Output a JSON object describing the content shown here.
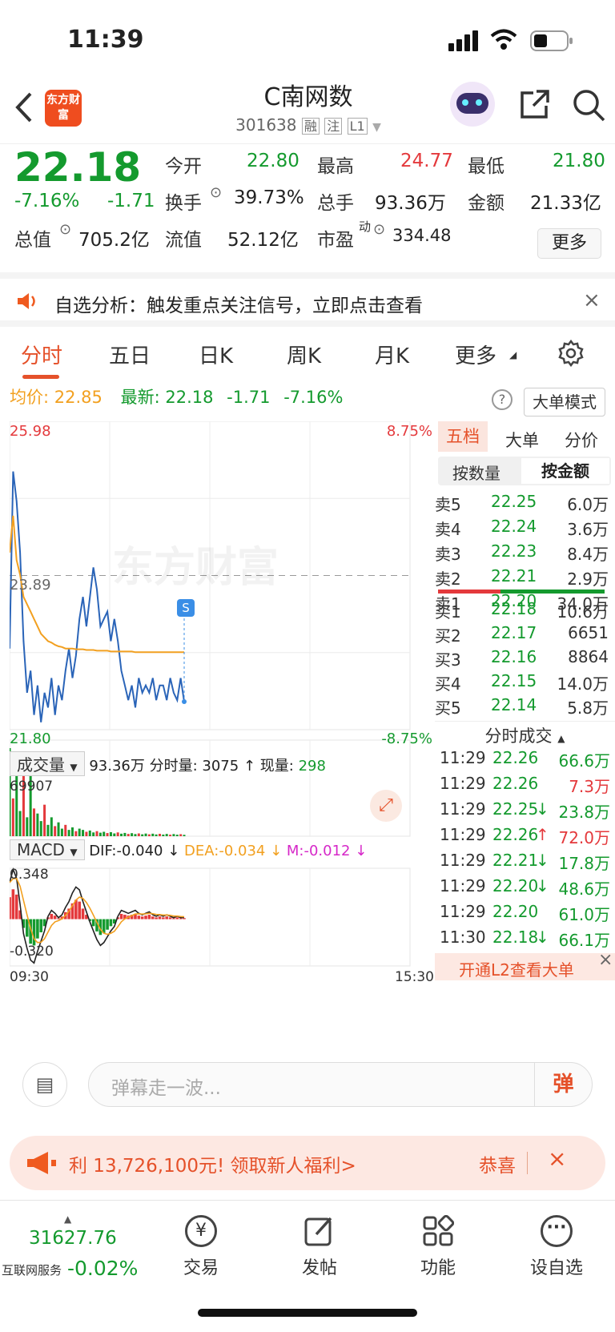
{
  "status": {
    "time": "11:39"
  },
  "header": {
    "title": "C南网数",
    "code": "301638",
    "tags": [
      "融",
      "注",
      "L1"
    ],
    "logo_text": "东方财富"
  },
  "quote": {
    "price": "22.18",
    "change_pct": "-7.16%",
    "change": "-1.71",
    "open_label": "今开",
    "open": "22.80",
    "high_label": "最高",
    "high": "24.77",
    "low_label": "最低",
    "low": "21.80",
    "turnover_label": "换手",
    "turnover": "39.73%",
    "volume_label": "总手",
    "volume": "93.36万",
    "amount_label": "金额",
    "amount": "21.33亿",
    "mktcap_label": "总值",
    "mktcap": "705.2亿",
    "float_label": "流值",
    "float": "52.12亿",
    "pe_label": "市盈",
    "pe_sup": "动",
    "pe": "334.48",
    "more_label": "更多"
  },
  "notice": {
    "text": "自选分析：触发重点关注信号，立即点击查看"
  },
  "tabs": [
    "分时",
    "五日",
    "日K",
    "周K",
    "月K",
    "更多"
  ],
  "infobar": {
    "avg_label": "均价:",
    "avg": "22.85",
    "latest_label": "最新:",
    "latest": "22.18",
    "latest_change": "-1.71",
    "latest_pct": "-7.16%",
    "mode_button": "大单模式"
  },
  "chart": {
    "price_top": "25.98",
    "pct_top": "8.75%",
    "price_mid": "23.89",
    "price_bottom": "21.80",
    "pct_bottom": "-8.75%",
    "watermark": "东方财富",
    "s_marker": "S",
    "vol_selector": "成交量",
    "vol_total": "93.36万",
    "vol_minute_label": "分时量:",
    "vol_minute": "3075",
    "vol_now_label": "现量:",
    "vol_now": "298",
    "vol_top": "69907",
    "macd_selector": "MACD",
    "dif": "DIF:-0.040",
    "dea": "DEA:-0.034",
    "m": "M:-0.012",
    "macd_top": "0.348",
    "macd_bottom": "-0.320",
    "time_start": "09:30",
    "time_end": "15:30"
  },
  "chart_data": {
    "type": "line",
    "title": "",
    "y_range": [
      21.8,
      25.98
    ],
    "prev_close": 23.89,
    "series": [
      {
        "values": [
          22.9,
          25.3,
          24.9,
          24.2,
          23.0,
          22.3,
          22.6,
          22.0,
          22.4,
          21.9,
          22.3,
          22.1,
          22.5,
          22.0,
          22.4,
          22.2,
          22.6,
          22.9,
          22.5,
          22.8,
          23.3,
          23.6,
          23.2,
          23.6,
          24.0,
          23.7,
          23.2,
          23.3,
          23.4,
          23.0,
          23.3,
          23.0,
          22.6,
          22.4,
          22.2,
          22.4,
          22.1,
          22.5,
          22.3,
          22.4,
          22.3,
          22.5,
          22.2,
          22.4,
          22.4,
          22.2,
          22.5,
          22.3,
          22.2,
          22.5,
          22.18
        ]
      },
      {
        "values": [
          24.2,
          24.7,
          24.1,
          23.9,
          23.6,
          23.5,
          23.4,
          23.3,
          23.2,
          23.1,
          23.05,
          23.0,
          22.98,
          22.95,
          22.93,
          22.92,
          22.9,
          22.9,
          22.9,
          22.89,
          22.89,
          22.89,
          22.88,
          22.88,
          22.88,
          22.87,
          22.87,
          22.87,
          22.87,
          22.86,
          22.86,
          22.86,
          22.86,
          22.86,
          22.86,
          22.86,
          22.85,
          22.85,
          22.85,
          22.85,
          22.85,
          22.85,
          22.85,
          22.85,
          22.85,
          22.85,
          22.85,
          22.85,
          22.85,
          22.85,
          22.85
        ]
      }
    ],
    "volume": [
      69907,
      30000,
      60000,
      20000,
      48000,
      15000,
      52000,
      22000,
      18000,
      12000,
      25000,
      9000,
      15000,
      8000,
      11000,
      6000,
      9000,
      5000,
      7000,
      4000,
      6000,
      5000,
      3500,
      4500,
      3000,
      4000,
      2800,
      3500,
      2500,
      3200,
      2200,
      3000,
      2000,
      2600,
      1800,
      2400,
      1700,
      2200,
      1500,
      2100,
      1500,
      2000,
      1400,
      1900,
      1300,
      1800,
      1200,
      1700,
      1200,
      1600,
      1100
    ],
    "macd": [
      0.25,
      0.34,
      0.28,
      0.1,
      -0.1,
      -0.2,
      -0.28,
      -0.3,
      -0.22,
      -0.15,
      -0.08,
      0.02,
      0.06,
      0.04,
      0.01,
      0.03,
      0.08,
      0.12,
      0.18,
      0.22,
      0.2,
      0.12,
      0.05,
      -0.02,
      -0.08,
      -0.14,
      -0.18,
      -0.16,
      -0.12,
      -0.08,
      -0.05,
      0.02,
      0.06,
      0.05,
      0.04,
      0.05,
      0.06,
      0.04,
      0.03,
      0.04,
      0.05,
      0.03,
      0.02,
      0.03,
      0.02,
      0.03,
      0.02,
      0.01,
      0.02,
      0.01,
      0.012
    ]
  },
  "panel": {
    "tabs": [
      "五档",
      "大单",
      "分价"
    ],
    "subtabs": [
      "按数量",
      "按金额"
    ],
    "asks": [
      {
        "label": "卖5",
        "price": "22.25",
        "amt": "6.0万"
      },
      {
        "label": "卖4",
        "price": "22.24",
        "amt": "3.6万"
      },
      {
        "label": "卖3",
        "price": "22.23",
        "amt": "8.4万"
      },
      {
        "label": "卖2",
        "price": "22.21",
        "amt": "2.9万"
      },
      {
        "label": "卖1",
        "price": "22.20",
        "amt": "34.0万"
      }
    ],
    "bids": [
      {
        "label": "买1",
        "price": "22.18",
        "amt": "10.6万"
      },
      {
        "label": "买2",
        "price": "22.17",
        "amt": "6651"
      },
      {
        "label": "买3",
        "price": "22.16",
        "amt": "8864"
      },
      {
        "label": "买4",
        "price": "22.15",
        "amt": "14.0万"
      },
      {
        "label": "买5",
        "price": "22.14",
        "amt": "5.8万"
      }
    ],
    "trades_title": "分时成交",
    "trades": [
      {
        "time": "11:29",
        "price": "22.26",
        "arrow": "",
        "amt": "66.6万",
        "color": "green"
      },
      {
        "time": "11:29",
        "price": "22.26",
        "arrow": "",
        "amt": "7.3万",
        "color": "red"
      },
      {
        "time": "11:29",
        "price": "22.25",
        "arrow": "↓",
        "amt": "23.8万",
        "color": "green"
      },
      {
        "time": "11:29",
        "price": "22.26",
        "arrow": "↑",
        "amt": "72.0万",
        "color": "red"
      },
      {
        "time": "11:29",
        "price": "22.21",
        "arrow": "↓",
        "amt": "17.8万",
        "color": "green"
      },
      {
        "time": "11:29",
        "price": "22.20",
        "arrow": "↓",
        "amt": "48.6万",
        "color": "green"
      },
      {
        "time": "11:29",
        "price": "22.20",
        "arrow": "",
        "amt": "61.0万",
        "color": "green"
      },
      {
        "time": "11:30",
        "price": "22.18",
        "arrow": "↓",
        "amt": "66.1万",
        "color": "green"
      }
    ],
    "l2_text": "开通L2查看大单"
  },
  "danmu": {
    "placeholder": "弹幕走一波...",
    "button": "弹"
  },
  "ad": {
    "text": "利 13,726,100元! 领取新人福利>",
    "right": "恭喜"
  },
  "bottom": {
    "index_value": "31627.76",
    "index_label": "互联网服务",
    "index_pct": "-0.02%",
    "items": [
      "交易",
      "发帖",
      "功能",
      "设自选"
    ]
  },
  "colors": {
    "up": "#e4393c",
    "down": "#149a2e",
    "accent": "#e5512a",
    "avg_line": "#f2a020",
    "price_line": "#2a64b8"
  }
}
